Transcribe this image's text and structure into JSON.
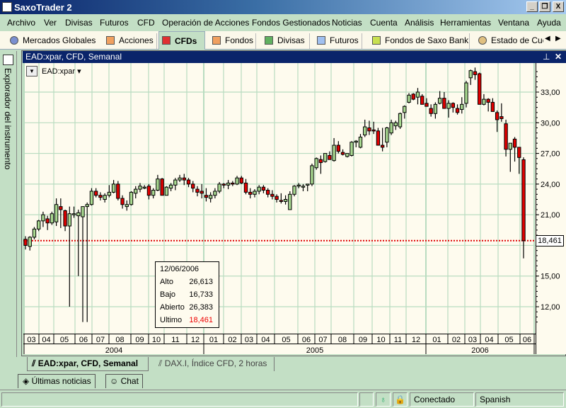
{
  "window": {
    "title": "SaxoTrader 2"
  },
  "menu": [
    "Archivo",
    "Ver",
    "Divisas",
    "Futuros",
    "CFD",
    "Operación de Acciones",
    "Fondos Gestionados",
    "Noticias",
    "Cuenta",
    "Análisis",
    "Herramientas",
    "Ventana",
    "Ayuda"
  ],
  "tabs": [
    {
      "label": "Mercados Globales"
    },
    {
      "label": "Acciones"
    },
    {
      "label": "CFDs",
      "active": true
    },
    {
      "label": "Fondos"
    },
    {
      "label": "Divisas"
    },
    {
      "label": "Futuros"
    },
    {
      "label": "Fondos de Saxo Bank"
    },
    {
      "label": "Estado de Cuer"
    }
  ],
  "sidebar": {
    "label": "Explorador del instrumento"
  },
  "chart_window": {
    "title": "EAD:xpar, CFD, Semanal",
    "symbol": "EAD:xpar"
  },
  "tooltip": {
    "date": "12/06/2006",
    "rows": [
      {
        "label": "Alto",
        "value": "26,613"
      },
      {
        "label": "Bajo",
        "value": "16,733"
      },
      {
        "label": "Abierto",
        "value": "26,383"
      },
      {
        "label": "Ultimo",
        "value": "18,461"
      }
    ]
  },
  "colors": {
    "up": "#a8d890",
    "down": "#e00000",
    "grid": "#b9dcc0",
    "last_line": "#e00000"
  },
  "chart_data": {
    "type": "candlestick",
    "title": "EAD:xpar, CFD, Semanal",
    "ylim": [
      9.8,
      35.7
    ],
    "y_ticks": [
      {
        "v": 33,
        "label": "33,00"
      },
      {
        "v": 30,
        "label": "30,00"
      },
      {
        "v": 27,
        "label": "27,00"
      },
      {
        "v": 24,
        "label": "24,00"
      },
      {
        "v": 21,
        "label": "21,00"
      },
      {
        "v": 15,
        "label": "15,00"
      },
      {
        "v": 12,
        "label": "12,00"
      }
    ],
    "last_value": 18.461,
    "last_label": "18,461",
    "months": [
      "03",
      "04",
      "05",
      "06",
      "07",
      "08",
      "09",
      "10",
      "11",
      "12",
      "01",
      "02",
      "03",
      "04",
      "05",
      "06",
      "07",
      "08",
      "09",
      "10",
      "11",
      "12",
      "01",
      "02",
      "03",
      "04",
      "05",
      "06"
    ],
    "years": [
      "2004",
      "2005",
      "2006"
    ],
    "ohlc": [
      [
        18.6,
        18.9,
        17.6,
        18.0
      ],
      [
        17.9,
        18.9,
        17.5,
        18.8
      ],
      [
        18.8,
        19.8,
        18.6,
        19.6
      ],
      [
        19.6,
        20.5,
        19.4,
        20.4
      ],
      [
        20.4,
        21.3,
        19.8,
        21.0
      ],
      [
        20.6,
        20.9,
        19.5,
        20.2
      ],
      [
        20.2,
        21.3,
        20.0,
        21.1
      ],
      [
        20.3,
        22.6,
        19.9,
        22.0
      ],
      [
        21.8,
        22.6,
        19.7,
        21.5
      ],
      [
        21.4,
        21.5,
        19.4,
        19.9
      ],
      [
        19.9,
        21.8,
        12.0,
        21.1
      ],
      [
        21.0,
        21.8,
        20.7,
        21.1
      ],
      [
        20.9,
        21.5,
        15.0,
        21.2
      ],
      [
        20.8,
        21.6,
        10.5,
        21.8
      ],
      [
        21.8,
        22.2,
        10.5,
        22.0
      ],
      [
        22.0,
        23.6,
        21.9,
        23.3
      ],
      [
        23.3,
        23.6,
        22.7,
        22.9
      ],
      [
        22.9,
        23.2,
        22.4,
        22.7
      ],
      [
        22.5,
        23.1,
        22.2,
        22.9
      ],
      [
        22.9,
        23.9,
        22.7,
        23.2
      ],
      [
        23.2,
        24.4,
        23.1,
        24.0
      ],
      [
        24.0,
        24.3,
        22.4,
        22.6
      ],
      [
        22.6,
        22.9,
        21.6,
        22.0
      ],
      [
        21.8,
        22.4,
        21.4,
        22.0
      ],
      [
        22.0,
        23.3,
        21.9,
        23.2
      ],
      [
        23.1,
        23.8,
        22.6,
        23.5
      ],
      [
        23.5,
        24.1,
        23.2,
        23.8
      ],
      [
        23.7,
        23.9,
        23.5,
        23.7
      ],
      [
        23.8,
        24.0,
        22.5,
        22.9
      ],
      [
        22.9,
        23.6,
        22.6,
        23.4
      ],
      [
        23.4,
        24.9,
        23.3,
        24.5
      ],
      [
        24.5,
        24.6,
        22.9,
        22.9
      ],
      [
        22.9,
        23.8,
        22.9,
        23.7
      ],
      [
        23.6,
        24.1,
        23.3,
        23.9
      ],
      [
        23.9,
        24.6,
        23.4,
        24.4
      ],
      [
        24.4,
        24.9,
        24.2,
        24.6
      ],
      [
        24.6,
        25.0,
        23.9,
        24.4
      ],
      [
        24.4,
        24.6,
        23.7,
        24.0
      ],
      [
        24.0,
        24.3,
        23.2,
        23.6
      ],
      [
        23.5,
        23.8,
        22.8,
        23.2
      ],
      [
        23.3,
        24.0,
        22.6,
        23.1
      ],
      [
        22.9,
        23.6,
        22.3,
        22.7
      ],
      [
        22.6,
        23.2,
        22.2,
        22.9
      ],
      [
        22.9,
        23.6,
        22.6,
        23.3
      ],
      [
        23.3,
        24.2,
        23.1,
        24.0
      ],
      [
        24.0,
        24.1,
        23.6,
        23.9
      ],
      [
        23.9,
        24.4,
        23.5,
        24.1
      ],
      [
        24.1,
        24.3,
        23.8,
        24.0
      ],
      [
        24.0,
        24.8,
        23.9,
        24.6
      ],
      [
        24.6,
        24.8,
        24.0,
        24.1
      ],
      [
        24.1,
        24.5,
        23.0,
        23.2
      ],
      [
        23.2,
        23.6,
        22.6,
        23.0
      ],
      [
        23.0,
        23.5,
        22.7,
        23.3
      ],
      [
        23.3,
        23.9,
        23.0,
        23.7
      ],
      [
        23.7,
        23.9,
        23.1,
        23.4
      ],
      [
        23.4,
        23.6,
        22.7,
        23.0
      ],
      [
        23.0,
        23.4,
        22.5,
        22.8
      ],
      [
        22.8,
        23.0,
        22.2,
        22.5
      ],
      [
        22.4,
        23.1,
        22.1,
        22.3
      ],
      [
        22.3,
        22.9,
        22.0,
        22.5
      ],
      [
        21.5,
        23.3,
        21.5,
        23.0
      ],
      [
        23.0,
        23.9,
        22.8,
        23.8
      ],
      [
        23.9,
        24.1,
        23.6,
        23.9
      ],
      [
        23.8,
        24.0,
        23.3,
        23.8
      ],
      [
        23.9,
        24.0,
        23.3,
        24.0
      ],
      [
        24.0,
        26.0,
        23.8,
        25.8
      ],
      [
        25.6,
        26.6,
        25.4,
        26.5
      ],
      [
        26.4,
        26.8,
        25.0,
        26.1
      ],
      [
        26.2,
        27.0,
        26.1,
        27.0
      ],
      [
        26.8,
        27.2,
        26.4,
        26.4
      ],
      [
        26.3,
        28.5,
        26.2,
        27.8
      ],
      [
        27.8,
        28.2,
        27.0,
        27.2
      ],
      [
        27.1,
        27.4,
        26.8,
        26.9
      ],
      [
        26.7,
        27.0,
        26.6,
        27.0
      ],
      [
        26.8,
        28.2,
        26.7,
        28.1
      ],
      [
        28.2,
        28.3,
        27.6,
        28.2
      ],
      [
        27.6,
        28.9,
        27.5,
        28.6
      ],
      [
        28.8,
        30.3,
        28.6,
        29.6
      ],
      [
        29.5,
        30.2,
        28.8,
        29.2
      ],
      [
        29.3,
        30.1,
        28.9,
        29.2
      ],
      [
        29.2,
        29.5,
        27.8,
        27.8
      ],
      [
        27.8,
        29.5,
        27.2,
        27.6
      ],
      [
        28.1,
        29.6,
        27.6,
        29.5
      ],
      [
        29.0,
        30.3,
        28.8,
        30.0
      ],
      [
        29.7,
        30.2,
        29.3,
        30.0
      ],
      [
        29.6,
        31.0,
        29.4,
        30.9
      ],
      [
        31.0,
        31.7,
        30.4,
        31.6
      ],
      [
        32.0,
        32.9,
        31.9,
        32.7
      ],
      [
        32.8,
        32.9,
        32.2,
        32.3
      ],
      [
        32.5,
        33.4,
        31.8,
        33.0
      ],
      [
        32.6,
        32.8,
        31.8,
        31.8
      ],
      [
        31.9,
        32.4,
        31.6,
        31.6
      ],
      [
        31.4,
        31.8,
        30.6,
        30.9
      ],
      [
        30.9,
        32.0,
        30.4,
        31.8
      ],
      [
        31.9,
        33.1,
        31.8,
        32.4
      ],
      [
        32.4,
        33.0,
        31.4,
        31.4
      ],
      [
        31.4,
        32.2,
        30.5,
        31.9
      ],
      [
        31.9,
        32.0,
        31.0,
        31.5
      ],
      [
        31.4,
        31.8,
        30.8,
        31.0
      ],
      [
        31.3,
        32.5,
        30.9,
        31.8
      ],
      [
        31.9,
        34.1,
        31.5,
        33.9
      ],
      [
        34.4,
        35.2,
        33.7,
        35.1
      ],
      [
        35.0,
        35.4,
        34.2,
        34.7
      ],
      [
        34.8,
        34.9,
        31.8,
        31.8
      ],
      [
        31.8,
        32.8,
        31.7,
        32.3
      ],
      [
        32.3,
        32.4,
        31.1,
        32.0
      ],
      [
        32.0,
        32.4,
        31.1,
        31.1
      ],
      [
        31.0,
        31.2,
        29.1,
        30.3
      ],
      [
        30.6,
        31.9,
        30.1,
        30.4
      ],
      [
        29.9,
        30.3,
        26.7,
        27.4
      ],
      [
        27.4,
        28.0,
        25.2,
        28.0
      ],
      [
        28.4,
        28.6,
        26.2,
        27.6
      ],
      [
        27.6,
        27.6,
        25.0,
        26.6
      ],
      [
        26.383,
        26.613,
        16.733,
        18.461
      ]
    ]
  },
  "bottom_tabs": [
    {
      "label": "EAD:xpar, CFD, Semanal",
      "active": true
    },
    {
      "label": "DAX.I, Índice CFD, 2 horas"
    }
  ],
  "panel_tabs": [
    {
      "label": "Últimas noticias"
    },
    {
      "label": "Chat"
    }
  ],
  "status": {
    "connection": "Conectado",
    "language": "Spanish"
  }
}
